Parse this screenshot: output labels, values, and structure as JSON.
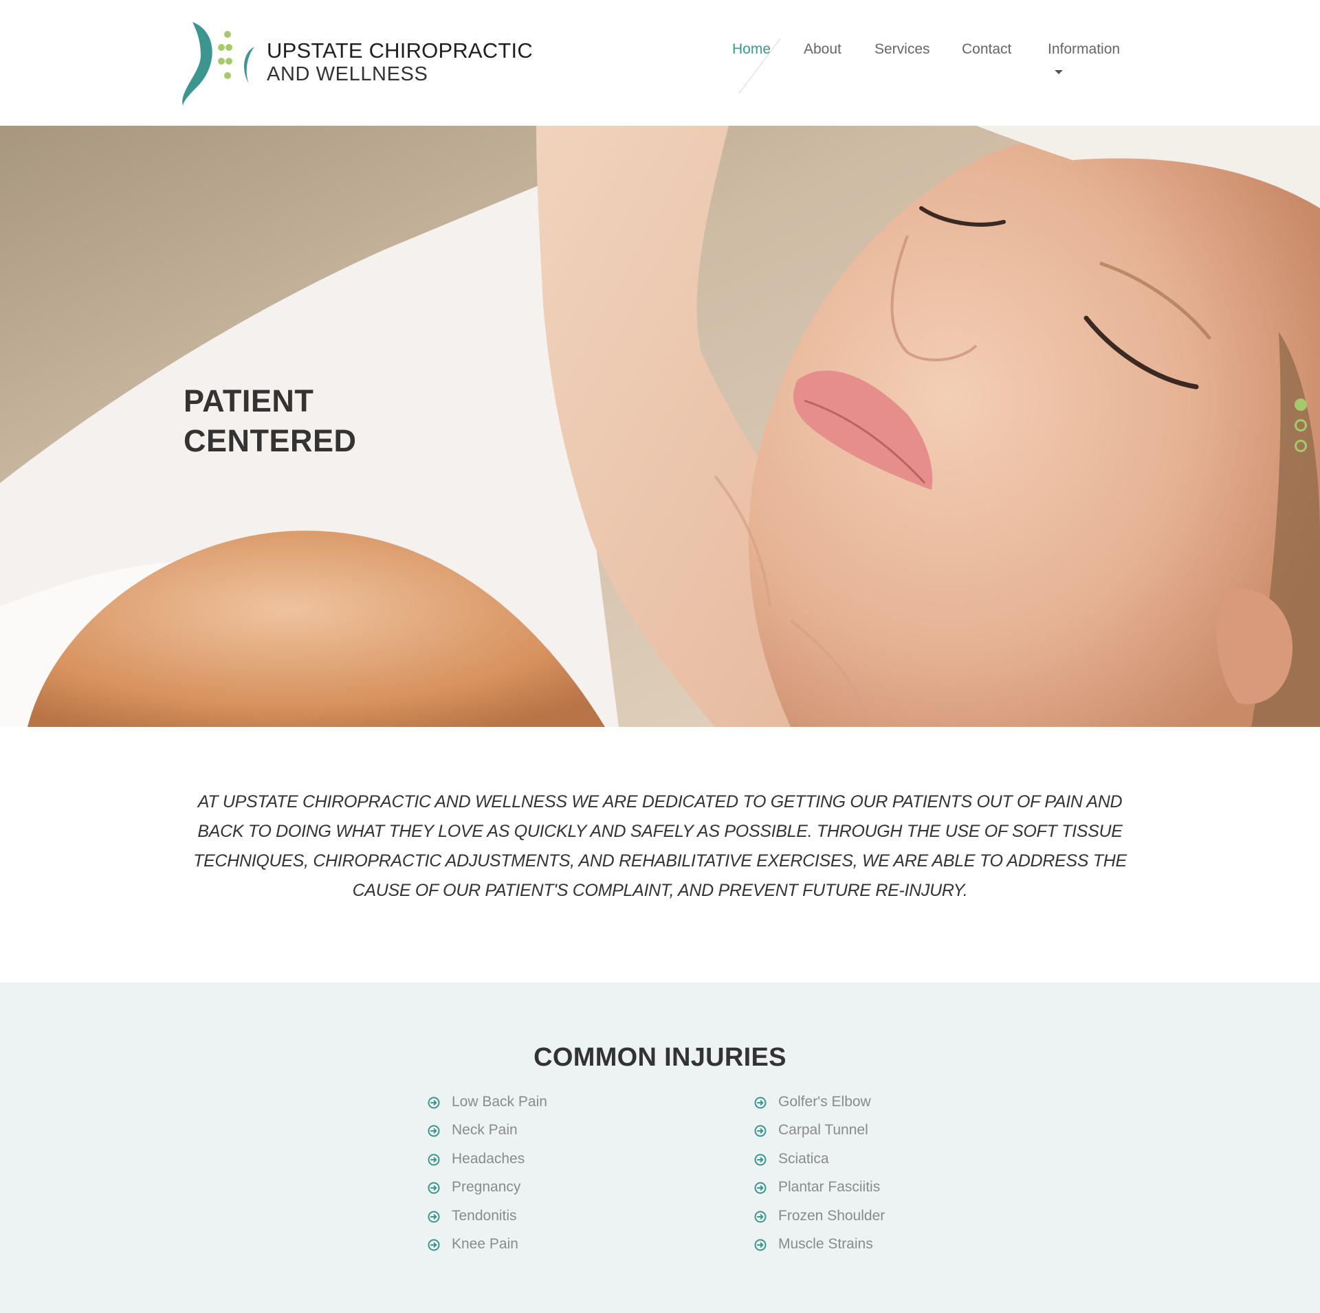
{
  "brand": {
    "line1": "UPSTATE CHIROPRACTIC",
    "line2": "AND WELLNESS",
    "colors": {
      "teal": "#3d9590",
      "green": "#a5c96b"
    }
  },
  "nav": {
    "items": [
      {
        "label": "Home",
        "active": true
      },
      {
        "label": "About"
      },
      {
        "label": "Services"
      },
      {
        "label": "Contact"
      },
      {
        "label": "Information",
        "has_dropdown": true
      }
    ]
  },
  "hero": {
    "title_line1": "PATIENT",
    "title_line2": "CENTERED",
    "slides_total": 3,
    "active_slide": 1
  },
  "intro": {
    "text": "At Upstate Chiropractic and Wellness we are dedicated to getting our patients out of pain and back to doing what they love as quickly and safely as possible. Through the use of soft tissue techniques, chiropractic adjustments, and rehabilitative exercises, we are able to address the cause of our patient's complaint, and prevent future re-injury."
  },
  "injuries": {
    "title": "COMMON INJURIES",
    "left": [
      "Low Back Pain",
      "Neck Pain",
      "Headaches",
      "Pregnancy",
      "Tendonitis",
      "Knee Pain"
    ],
    "right": [
      "Golfer's Elbow",
      "Carpal Tunnel",
      "Sciatica",
      "Plantar Fasciitis",
      "Frozen Shoulder",
      "Muscle Strains"
    ],
    "icon": "arrow-circle-right-icon"
  }
}
